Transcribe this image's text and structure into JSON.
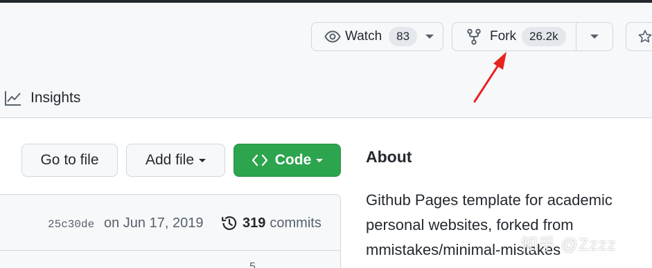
{
  "repo_header": {
    "watch": {
      "label": "Watch",
      "count": "83"
    },
    "fork": {
      "label": "Fork",
      "count": "26.2k"
    }
  },
  "nav": {
    "insights_label": "Insights"
  },
  "file_actions": {
    "go_to_file": "Go to file",
    "add_file": "Add file",
    "code": "Code"
  },
  "commit_bar": {
    "hash": "25c30de",
    "date": "on Jun 17, 2019",
    "commit_count": "319",
    "commits_label": "commits",
    "partial_digit": "5"
  },
  "about": {
    "heading": "About",
    "description_lines": [
      "Github Pages template for academic",
      "personal websites, forked from",
      "mmistakes/minimal-mistakes"
    ]
  },
  "watermark": "知乎 @Zzzz",
  "annotation": {
    "arrow_color": "#e8231f"
  },
  "colors": {
    "code_button": "#2da44e",
    "border": "#d0d7de",
    "header_bg": "#f6f8fa"
  }
}
